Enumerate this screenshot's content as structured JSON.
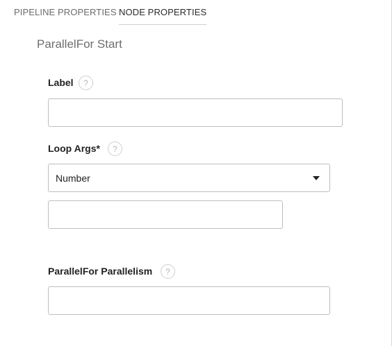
{
  "tabs": [
    {
      "label": "PIPELINE PROPERTIES",
      "active": false
    },
    {
      "label": "NODE PROPERTIES",
      "active": true
    }
  ],
  "node": {
    "title": "ParallelFor Start"
  },
  "fields": {
    "label": {
      "label": "Label",
      "help_icon": "question-mark-icon",
      "value": "",
      "placeholder": ""
    },
    "loop_args": {
      "label": "Loop Args*",
      "help_icon": "question-mark-icon",
      "type_selected": "Number",
      "value": "",
      "placeholder": ""
    },
    "parallelism": {
      "label": "ParallelFor Parallelism",
      "help_icon": "question-mark-icon",
      "value": "",
      "placeholder": ""
    }
  },
  "help_glyph": "?"
}
